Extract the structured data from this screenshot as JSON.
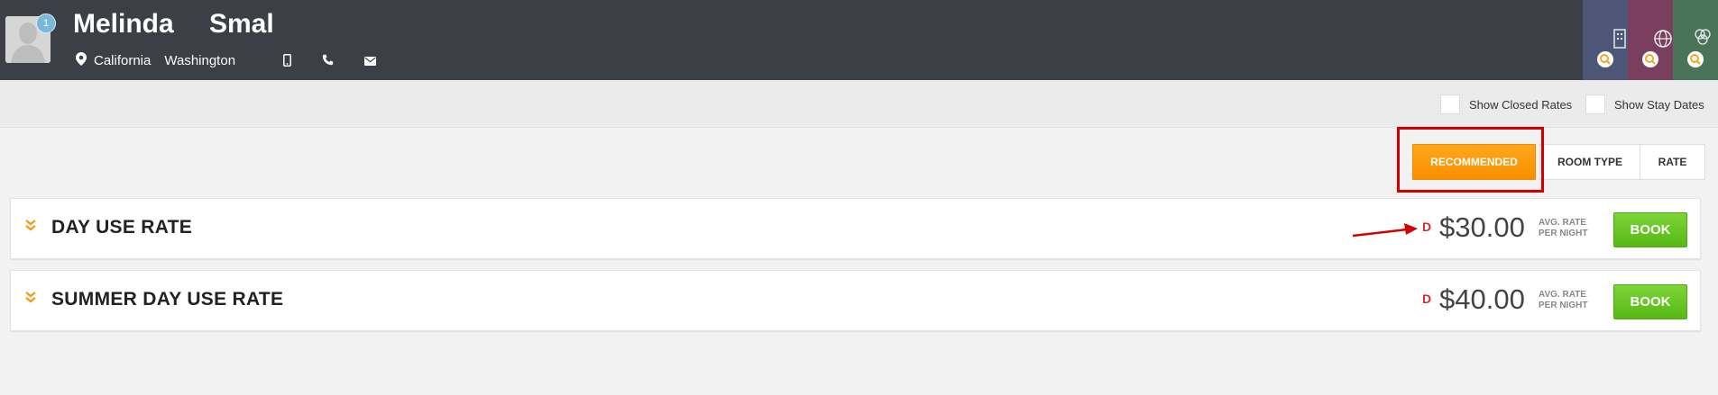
{
  "guest": {
    "first_name": "Melinda",
    "last_name": "Smal",
    "badge_count": "1",
    "city": "California",
    "state": "Washington",
    "icons": [
      "location-pin-icon",
      "mobile-phone-icon",
      "phone-icon",
      "email-icon"
    ]
  },
  "side_tiles": [
    {
      "icon": "building-icon",
      "color": "#4e5678"
    },
    {
      "icon": "globe-icon",
      "color": "#7a3e5e"
    },
    {
      "icon": "circles-icon",
      "color": "#4a7457"
    }
  ],
  "filters": {
    "show_closed_rates": "Show Closed Rates",
    "show_stay_dates": "Show Stay Dates"
  },
  "view_toggle": {
    "recommended": "RECOMMENDED",
    "room_type": "ROOM TYPE",
    "rate": "RATE",
    "active": "recommended"
  },
  "rates": [
    {
      "name": "DAY USE RATE",
      "code": "D",
      "price": "$30.00",
      "avg_line1": "AVG. RATE",
      "avg_line2": "PER NIGHT",
      "book_label": "BOOK"
    },
    {
      "name": "SUMMER DAY USE RATE",
      "code": "D",
      "price": "$40.00",
      "avg_line1": "AVG. RATE",
      "avg_line2": "PER NIGHT",
      "book_label": "BOOK"
    }
  ],
  "colors": {
    "header_bg": "#3c3f45",
    "accent_orange": "#f7941d",
    "book_green": "#62c41e",
    "rate_code_red": "#d62b2b",
    "annotation_red": "#d40000"
  }
}
